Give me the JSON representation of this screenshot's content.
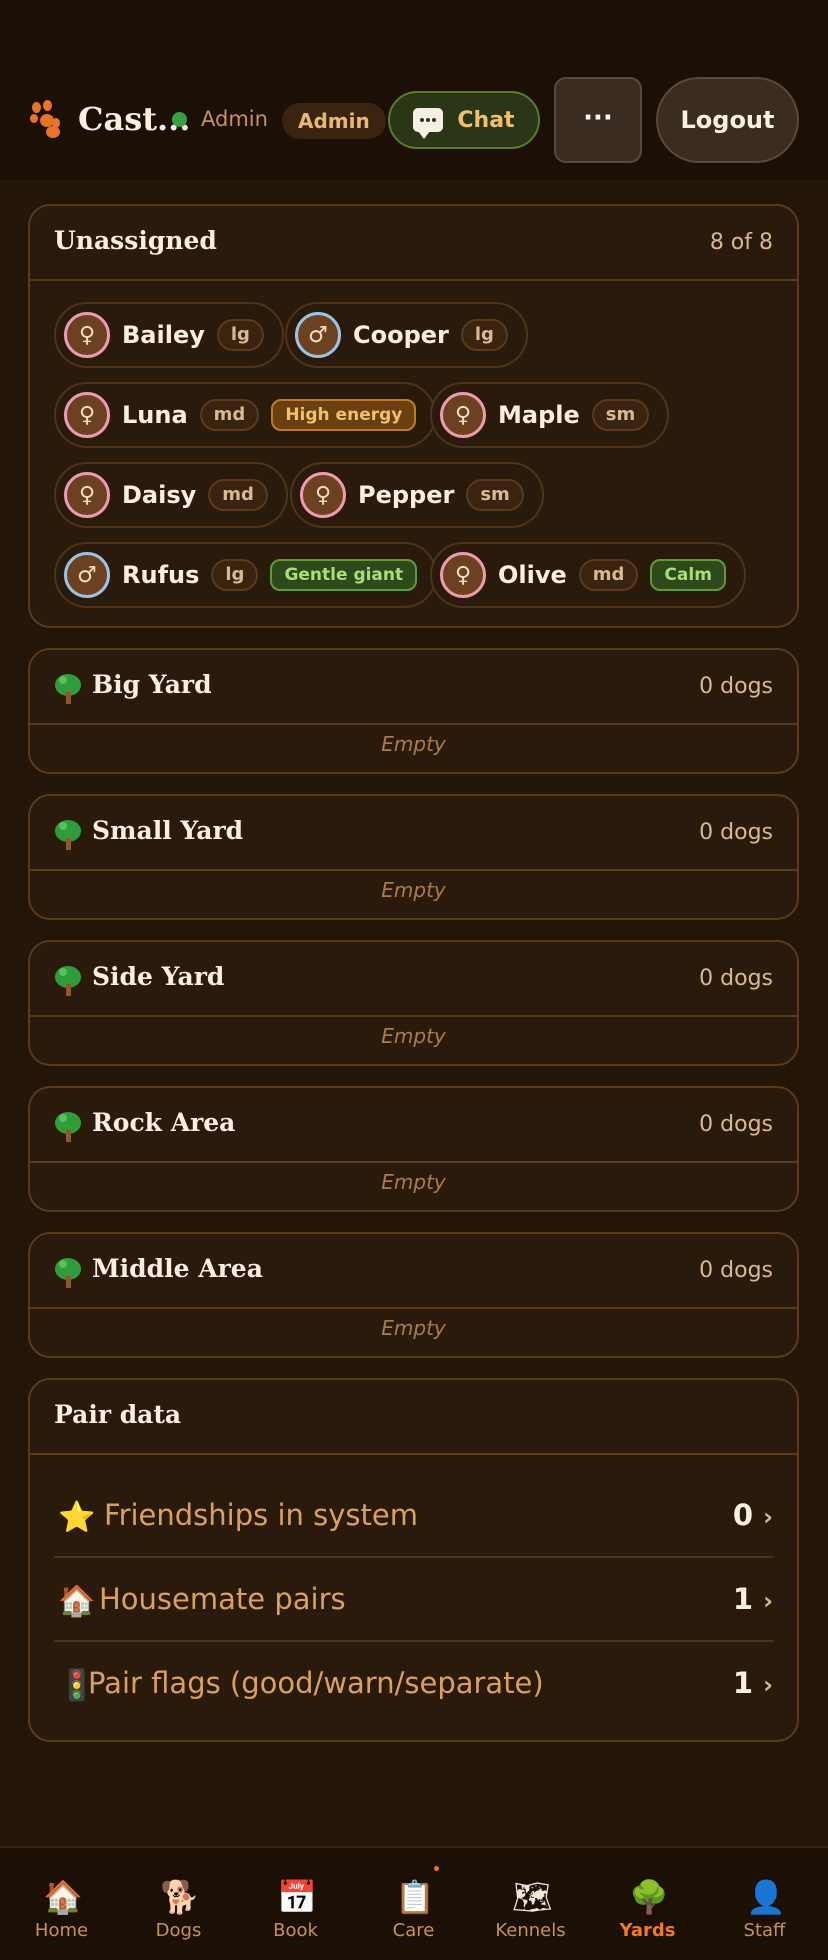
{
  "header": {
    "brand": "Cast...",
    "role_text": "Admin",
    "role_badge": "Admin",
    "chat_label": "Chat",
    "more_label": "···",
    "logout_label": "Logout"
  },
  "unassigned": {
    "title": "Unassigned",
    "count": "8 of 8",
    "dogs": [
      {
        "name": "Bailey",
        "sex": "♀",
        "size": "lg"
      },
      {
        "name": "Cooper",
        "sex": "♂",
        "size": "lg"
      },
      {
        "name": "Luna",
        "sex": "♀",
        "size": "md",
        "trait": "High energy"
      },
      {
        "name": "Maple",
        "sex": "♀",
        "size": "sm"
      },
      {
        "name": "Daisy",
        "sex": "♀",
        "size": "md"
      },
      {
        "name": "Pepper",
        "sex": "♀",
        "size": "sm"
      },
      {
        "name": "Rufus",
        "sex": "♂",
        "size": "lg",
        "trait": "Gentle giant"
      },
      {
        "name": "Olive",
        "sex": "♀",
        "size": "md",
        "trait": "Calm"
      }
    ]
  },
  "yards": [
    {
      "name": "Big Yard",
      "count": "0 dogs",
      "empty": "Empty"
    },
    {
      "name": "Small Yard",
      "count": "0 dogs",
      "empty": "Empty"
    },
    {
      "name": "Side Yard",
      "count": "0 dogs",
      "empty": "Empty"
    },
    {
      "name": "Rock Area",
      "count": "0 dogs",
      "empty": "Empty"
    },
    {
      "name": "Middle Area",
      "count": "0 dogs",
      "empty": "Empty"
    }
  ],
  "pair_data": {
    "title": "Pair data",
    "rows": [
      {
        "icon": "star-icon",
        "glyph": "⭐",
        "label": "Friendships in system",
        "value": "0",
        "chevron": "›"
      },
      {
        "icon": "house-icon",
        "glyph": "🏠",
        "label": "Housemate pairs",
        "value": "1",
        "chevron": "›"
      },
      {
        "icon": "traffic-light-icon",
        "glyph": "🚦",
        "label": "Pair flags (good/warn/separate)",
        "value": "1",
        "chevron": "›"
      }
    ]
  },
  "nav": [
    {
      "label": "Home",
      "icon": "house-icon",
      "glyph": "🏠"
    },
    {
      "label": "Dogs",
      "icon": "dog-icon",
      "glyph": "🐕"
    },
    {
      "label": "Book",
      "icon": "calendar-icon",
      "glyph": "📅"
    },
    {
      "label": "Care",
      "icon": "clipboard-icon",
      "glyph": "📋"
    },
    {
      "label": "Kennels",
      "icon": "map-icon",
      "glyph": "🗺"
    },
    {
      "label": "Yards",
      "icon": "tree-icon",
      "glyph": "🌳"
    },
    {
      "label": "Staff",
      "icon": "staff-icon",
      "glyph": "👤"
    }
  ],
  "colors": {
    "background": "#231508",
    "accent": "#ef7a2a",
    "female_ring": "#ec9bb0",
    "male_ring": "#9cc3e6"
  }
}
